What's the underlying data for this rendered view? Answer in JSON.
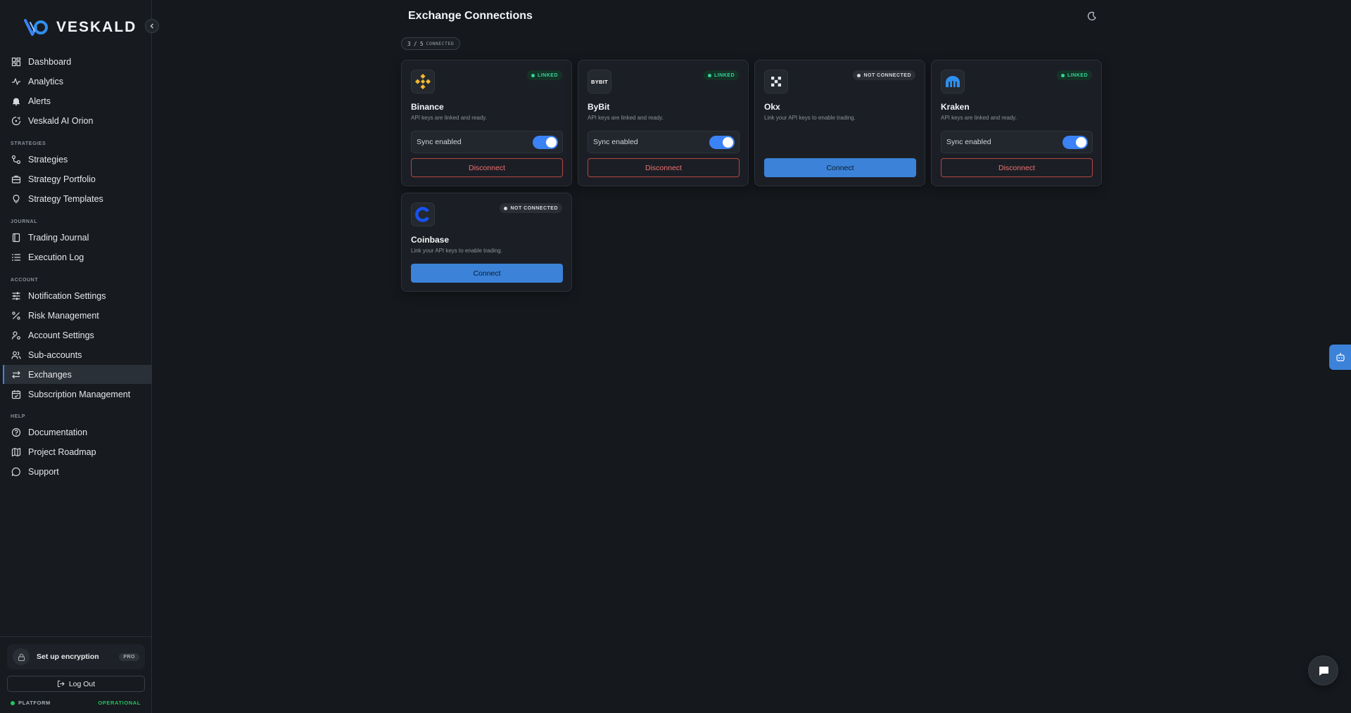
{
  "app": {
    "brand": "VESKALD"
  },
  "sidebar": {
    "items_top": [
      {
        "label": "Dashboard",
        "icon": "dashboard-icon"
      },
      {
        "label": "Analytics",
        "icon": "analytics-icon"
      },
      {
        "label": "Alerts",
        "icon": "bell-icon"
      },
      {
        "label": "Veskald AI Orion",
        "icon": "orion-icon"
      }
    ],
    "sections": {
      "strategies": "STRATEGIES",
      "journal": "JOURNAL",
      "account": "ACCOUNT",
      "help": "HELP"
    },
    "strategies_items": [
      {
        "label": "Strategies",
        "icon": "strategies-icon"
      },
      {
        "label": "Strategy Portfolio",
        "icon": "briefcase-icon"
      },
      {
        "label": "Strategy Templates",
        "icon": "lightbulb-icon"
      }
    ],
    "journal_items": [
      {
        "label": "Trading Journal",
        "icon": "book-icon"
      },
      {
        "label": "Execution Log",
        "icon": "list-icon"
      }
    ],
    "account_items": [
      {
        "label": "Notification Settings",
        "icon": "sliders-icon"
      },
      {
        "label": "Risk Management",
        "icon": "percent-icon"
      },
      {
        "label": "Account Settings",
        "icon": "user-gear-icon"
      },
      {
        "label": "Sub-accounts",
        "icon": "users-icon"
      },
      {
        "label": "Exchanges",
        "icon": "arrows-swap-icon",
        "active": true
      },
      {
        "label": "Subscription Management",
        "icon": "calendar-check-icon"
      }
    ],
    "help_items": [
      {
        "label": "Documentation",
        "icon": "question-icon"
      },
      {
        "label": "Project Roadmap",
        "icon": "map-icon"
      },
      {
        "label": "Support",
        "icon": "chat-bubble-icon"
      }
    ],
    "encryption": {
      "label": "Set up encryption",
      "badge": "PRO"
    },
    "logout_label": "Log Out",
    "platform": {
      "label": "PLATFORM",
      "status": "OPERATIONAL",
      "status_color": "#22c55e"
    }
  },
  "main": {
    "title": "Exchange Connections",
    "connected_count": "3 / 5",
    "connected_label": "CONNECTED",
    "cards": [
      {
        "name": "Binance",
        "status": "LINKED",
        "desc": "API keys are linked and ready.",
        "sync_label": "Sync enabled",
        "sync_on": true,
        "action": "Disconnect"
      },
      {
        "name": "ByBit",
        "status": "LINKED",
        "desc": "API keys are linked and ready.",
        "sync_label": "Sync enabled",
        "sync_on": true,
        "action": "Disconnect"
      },
      {
        "name": "Okx",
        "status": "NOT CONNECTED",
        "desc": "Link your API keys to enable trading.",
        "action": "Connect"
      },
      {
        "name": "Kraken",
        "status": "LINKED",
        "desc": "API keys are linked and ready.",
        "sync_label": "Sync enabled",
        "sync_on": true,
        "action": "Disconnect"
      },
      {
        "name": "Coinbase",
        "status": "NOT CONNECTED",
        "desc": "Link your API keys to enable trading.",
        "action": "Connect"
      }
    ],
    "bybit_logo_text": "BYBIT"
  },
  "colors": {
    "accent": "#3b82d8",
    "linked": "#34d399",
    "danger": "#f07171",
    "binance": "#f3ba2f",
    "kraken": "#2f8fef",
    "coinbase": "#1652f0"
  }
}
